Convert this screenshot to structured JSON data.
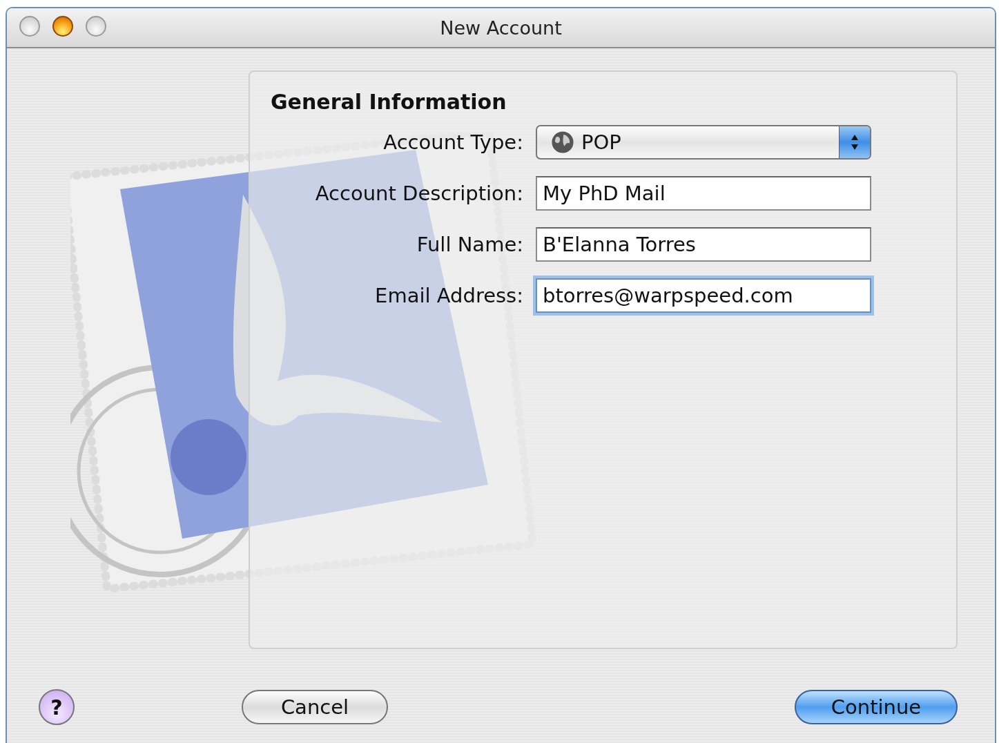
{
  "window": {
    "title": "New Account"
  },
  "section": {
    "heading": "General Information"
  },
  "fields": [
    {
      "kind": "popup",
      "label": "Account Type:",
      "value": "POP",
      "focused": false
    },
    {
      "kind": "text",
      "label": "Account Description:",
      "value": "My PhD Mail",
      "focused": false
    },
    {
      "kind": "text",
      "label": "Full Name:",
      "value": "B'Elanna Torres",
      "focused": false
    },
    {
      "kind": "text",
      "label": "Email Address:",
      "value": "btorres@warpspeed.com",
      "focused": true
    }
  ],
  "help_button": {
    "label": "?"
  },
  "buttons": [
    {
      "label": "Cancel",
      "default": false
    },
    {
      "label": "Continue",
      "default": true
    }
  ]
}
